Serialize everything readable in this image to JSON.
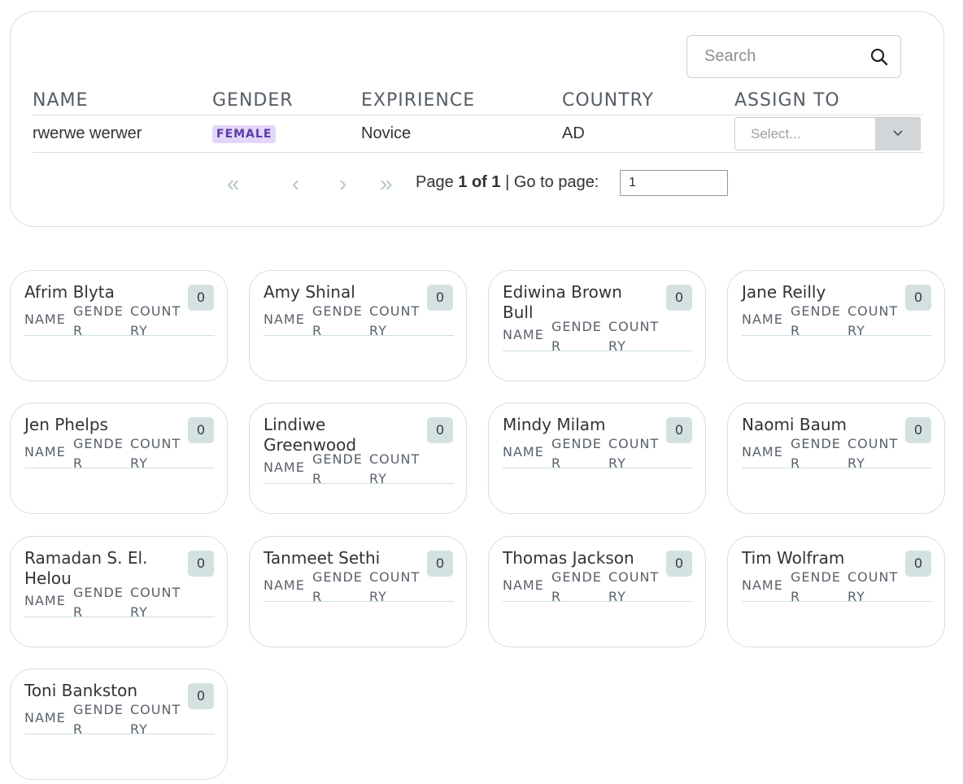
{
  "search": {
    "placeholder": "Search"
  },
  "table": {
    "headers": [
      "NAME",
      "GENDER",
      "EXPIRIENCE",
      "COUNTRY",
      "ASSIGN TO"
    ],
    "rows": [
      {
        "name": "rwerwe werwer",
        "gender": "FEMALE",
        "experience": "Novice",
        "country": "AD",
        "assign_placeholder": "Select..."
      }
    ]
  },
  "pagination": {
    "first": "«",
    "prev": "‹",
    "next": "›",
    "last": "»",
    "page_label": "Page",
    "page_value": "1 of 1",
    "goto_label": "| Go to page:",
    "goto_value": "1"
  },
  "cards": [
    {
      "name": "Afrim Blyta",
      "count": "0"
    },
    {
      "name": "Amy Shinal",
      "count": "0"
    },
    {
      "name": "Ediwina Brown Bull",
      "count": "0"
    },
    {
      "name": "Jane Reilly",
      "count": "0"
    },
    {
      "name": "Jen Phelps",
      "count": "0"
    },
    {
      "name": "Lindiwe Greenwood",
      "count": "0"
    },
    {
      "name": "Mindy Milam",
      "count": "0"
    },
    {
      "name": "Naomi Baum",
      "count": "0"
    },
    {
      "name": "Ramadan S. El. Helou",
      "count": "0"
    },
    {
      "name": "Tanmeet Sethi",
      "count": "0"
    },
    {
      "name": "Thomas Jackson",
      "count": "0"
    },
    {
      "name": "Tim Wolfram",
      "count": "0"
    },
    {
      "name": "Toni Bankston",
      "count": "0"
    }
  ],
  "card_headers": {
    "name": "NAME",
    "gender": "GENDER",
    "country": "COUNTRY"
  }
}
